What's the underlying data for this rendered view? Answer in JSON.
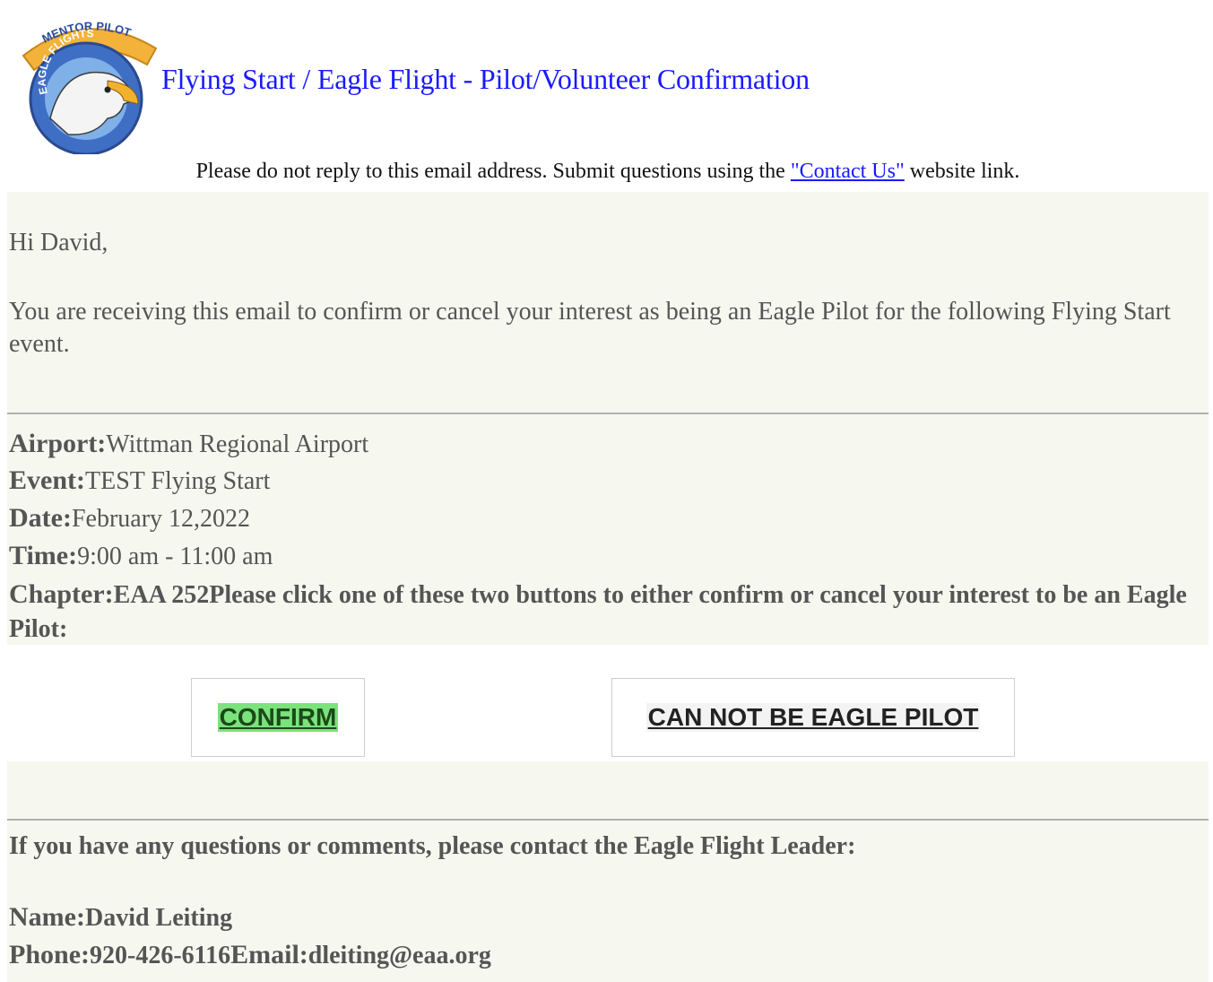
{
  "header": {
    "logo_top_text": "MENTOR PILOT",
    "logo_ring_text": "EAGLE FLIGHTS",
    "title": "Flying Start / Eagle Flight - Pilot/Volunteer Confirmation"
  },
  "notice": {
    "before": "Please do not reply to this email address. Submit questions using the ",
    "link": "\"Contact Us\"",
    "after": " website link."
  },
  "body": {
    "greeting": "Hi David,",
    "intro": "You are receiving this email to confirm or cancel your interest as being an Eagle Pilot for the following Flying Start event."
  },
  "event": {
    "airport_label": "Airport:",
    "airport_value": "Wittman Regional Airport",
    "event_label": "Event:",
    "event_value": "TEST Flying Start",
    "date_label": "Date:",
    "date_value": "February 12,2022",
    "time_label": "Time:",
    "time_value": "9:00 am - 11:00 am",
    "chapter_label": "Chapter:",
    "chapter_value": "EAA 252",
    "instruction": "Please click one of these two buttons to either confirm or cancel your interest to be an Eagle Pilot:"
  },
  "buttons": {
    "confirm": "CONFIRM",
    "cancel": "CAN NOT BE EAGLE PILOT"
  },
  "contact": {
    "question": "If you have any questions or comments, please contact the Eagle Flight Leader:",
    "name_label": "Name:",
    "name_value": "David Leiting",
    "phone_label": "Phone:",
    "phone_value": "920-426-6116",
    "email_label": "Email:",
    "email_value": "dleiting@eaa.org"
  },
  "colors": {
    "title_blue": "#1a1aff",
    "panel_bg": "#f6f8f0",
    "confirm_green": "#7be37b"
  }
}
